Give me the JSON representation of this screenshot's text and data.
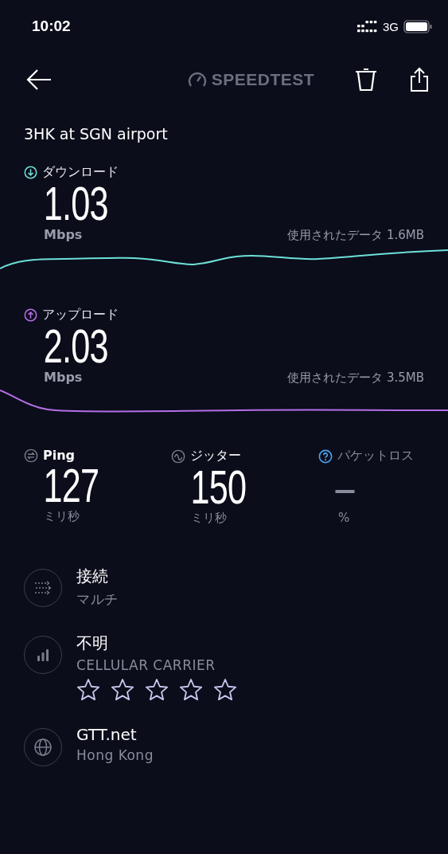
{
  "status_bar": {
    "time": "10:02",
    "network": "3G"
  },
  "header": {
    "logo": "SPEEDTEST"
  },
  "test_name": "3HK at SGN airport",
  "results": [
    {
      "kind": "download",
      "label": "ダウンロード",
      "value": "1.03",
      "unit": "Mbps",
      "data_used": "使用されたデータ 1.6MB",
      "color": "#6ee0d8"
    },
    {
      "kind": "upload",
      "label": "アップロード",
      "value": "2.03",
      "unit": "Mbps",
      "data_used": "使用されたデータ 3.5MB",
      "color": "#b56ee8"
    }
  ],
  "metrics": [
    {
      "kind": "ping",
      "label": "Ping",
      "value": "127",
      "unit": "ミリ秒",
      "disabled": false
    },
    {
      "kind": "jitter",
      "label": "ジッター",
      "value": "150",
      "unit": "ミリ秒",
      "disabled": false
    },
    {
      "kind": "packet_loss",
      "label": "パケットロス",
      "value": "–",
      "unit": "%",
      "disabled": true
    }
  ],
  "details": [
    {
      "kind": "connection",
      "title": "接続",
      "subtitle": "マルチ"
    },
    {
      "kind": "carrier",
      "title": "不明",
      "subtitle": "CELLULAR CARRIER",
      "stars": 0
    },
    {
      "kind": "server",
      "title": "GTT.net",
      "subtitle": "Hong Kong"
    }
  ]
}
